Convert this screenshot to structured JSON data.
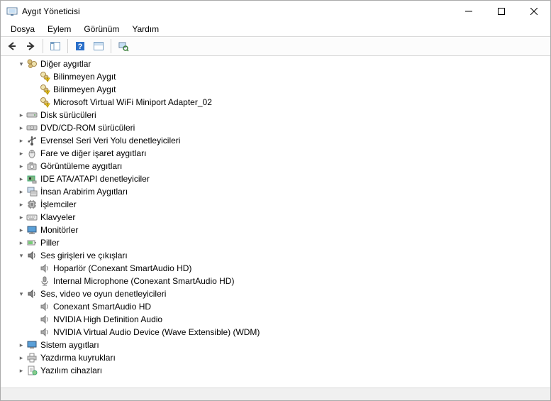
{
  "window": {
    "title": "Aygıt Yöneticisi"
  },
  "menu": {
    "file": "Dosya",
    "action": "Eylem",
    "view": "Görünüm",
    "help": "Yardım"
  },
  "tree": {
    "other_devices": "Diğer aygıtlar",
    "unknown_device_1": "Bilinmeyen Aygıt",
    "unknown_device_2": "Bilinmeyen Aygıt",
    "ms_virtual_wifi": "Microsoft Virtual WiFi Miniport Adapter_02",
    "disk_drives": "Disk sürücüleri",
    "dvd_cd": "DVD/CD-ROM sürücüleri",
    "usb_controllers": "Evrensel Seri Veri Yolu denetleyicileri",
    "mice": "Fare ve diğer işaret aygıtları",
    "imaging": "Görüntüleme aygıtları",
    "ide_atapi": "IDE ATA/ATAPI denetleyiciler",
    "hid": "İnsan Arabirim Aygıtları",
    "processors": "İşlemciler",
    "keyboards": "Klavyeler",
    "monitors": "Monitörler",
    "batteries": "Piller",
    "audio_io": "Ses girişleri ve çıkışları",
    "speaker": "Hoparlör (Conexant SmartAudio HD)",
    "internal_mic": "Internal Microphone (Conexant SmartAudio HD)",
    "sound_video_game": "Ses, video ve oyun denetleyicileri",
    "conexant": "Conexant SmartAudio HD",
    "nvidia_hda": "NVIDIA High Definition Audio",
    "nvidia_virtual": "NVIDIA Virtual Audio Device (Wave Extensible) (WDM)",
    "system_devices": "Sistem aygıtları",
    "print_queues": "Yazdırma kuyrukları",
    "software_devices": "Yazılım cihazları"
  }
}
